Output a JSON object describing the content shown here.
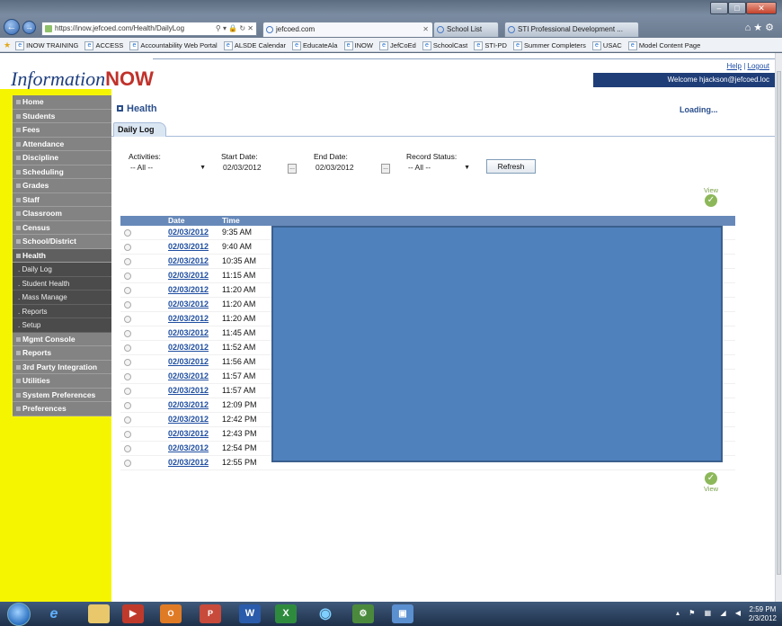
{
  "browser": {
    "url": "https://inow.jefcoed.com/Health/DailyLog",
    "tabs": [
      {
        "label": "jefcoed.com",
        "active": true
      },
      {
        "label": "School List",
        "active": false
      },
      {
        "label": "STI Professional Development ...",
        "active": false
      }
    ],
    "favorites": [
      "INOW TRAINING",
      "ACCESS",
      "Accountability Web Portal",
      "ALSDE Calendar",
      "EducateAla",
      "INOW",
      "JefCoEd",
      "SchoolCast",
      "STI-PD",
      "Summer Completers",
      "USAC",
      "Model Content Page"
    ]
  },
  "header": {
    "logo_prefix": "Information",
    "logo_suffix": "NOW",
    "help": "Help",
    "separator": "|",
    "logout": "Logout",
    "welcome": "Welcome hjackson@jefcoed.loc"
  },
  "sidebar": {
    "items": [
      {
        "label": "Home"
      },
      {
        "label": "Students"
      },
      {
        "label": "Fees"
      },
      {
        "label": "Attendance"
      },
      {
        "label": "Discipline"
      },
      {
        "label": "Scheduling"
      },
      {
        "label": "Grades"
      },
      {
        "label": "Staff"
      },
      {
        "label": "Classroom"
      },
      {
        "label": "Census"
      },
      {
        "label": "School/District"
      },
      {
        "label": "Health"
      }
    ],
    "health_sub": [
      ". Daily Log",
      ". Student Health",
      ". Mass Manage",
      ". Reports",
      ". Setup"
    ],
    "items_after": [
      {
        "label": "Mgmt Console"
      },
      {
        "label": "Reports"
      },
      {
        "label": "3rd Party Integration"
      },
      {
        "label": "Utilities"
      },
      {
        "label": "System Preferences"
      },
      {
        "label": "Preferences"
      }
    ]
  },
  "main": {
    "title": "Health",
    "status": "Loading...",
    "tab": "Daily Log",
    "filters": {
      "activities_label": "Activities:",
      "activities_value": "-- All --",
      "start_label": "Start Date:",
      "start_value": "02/03/2012",
      "end_label": "End Date:",
      "end_value": "02/03/2012",
      "status_label": "Record Status:",
      "status_value": "-- All --",
      "cal_button": "...",
      "refresh": "Refresh"
    },
    "view_label": "View",
    "grid": {
      "columns": [
        "Date",
        "Time"
      ],
      "rows": [
        {
          "date": "02/03/2012",
          "time": "9:35 AM"
        },
        {
          "date": "02/03/2012",
          "time": "9:40 AM"
        },
        {
          "date": "02/03/2012",
          "time": "10:35 AM"
        },
        {
          "date": "02/03/2012",
          "time": "11:15 AM"
        },
        {
          "date": "02/03/2012",
          "time": "11:20 AM"
        },
        {
          "date": "02/03/2012",
          "time": "11:20 AM"
        },
        {
          "date": "02/03/2012",
          "time": "11:20 AM"
        },
        {
          "date": "02/03/2012",
          "time": "11:45 AM"
        },
        {
          "date": "02/03/2012",
          "time": "11:52 AM"
        },
        {
          "date": "02/03/2012",
          "time": "11:56 AM"
        },
        {
          "date": "02/03/2012",
          "time": "11:57 AM"
        },
        {
          "date": "02/03/2012",
          "time": "11:57 AM"
        },
        {
          "date": "02/03/2012",
          "time": "12:09 PM"
        },
        {
          "date": "02/03/2012",
          "time": "12:42 PM"
        },
        {
          "date": "02/03/2012",
          "time": "12:43 PM"
        },
        {
          "date": "02/03/2012",
          "time": "12:54 PM"
        },
        {
          "date": "02/03/2012",
          "time": "12:55 PM"
        }
      ]
    }
  },
  "taskbar": {
    "time": "2:59 PM",
    "date": "2/3/2012"
  }
}
